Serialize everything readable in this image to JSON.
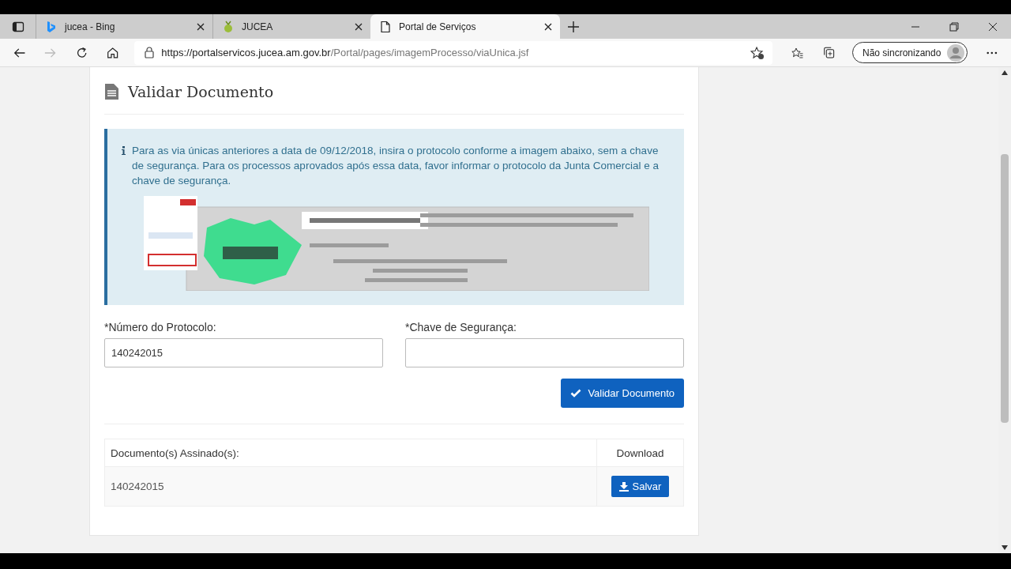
{
  "browser": {
    "tabs": [
      {
        "title": "jucea - Bing",
        "selected": false
      },
      {
        "title": "JUCEA",
        "selected": false
      },
      {
        "title": "Portal de Serviços",
        "selected": true
      }
    ],
    "url_host": "https://portalservicos.jucea.am.gov.br",
    "url_path": "/Portal/pages/imagemProcesso/viaUnica.jsf",
    "profile_label": "Não sincronizando"
  },
  "page": {
    "title": "Validar Documento",
    "info_text": "Para as via únicas anteriores a data de 09/12/2018, insira o protocolo conforme a imagem abaixo, sem a chave de segurança. Para os processos aprovados após essa data, favor informar o protocolo da Junta Comercial e a chave de segurança.",
    "fields": [
      {
        "label": "*Número do Protocolo:",
        "value": "140242015"
      },
      {
        "label": "*Chave de Segurança:"
      }
    ],
    "submit_button": "Validar Documento",
    "table": {
      "columns": [
        "Documento(s) Assinado(s):",
        "Download"
      ],
      "rows": [
        {
          "document": "140242015",
          "action": "Salvar"
        }
      ]
    }
  }
}
